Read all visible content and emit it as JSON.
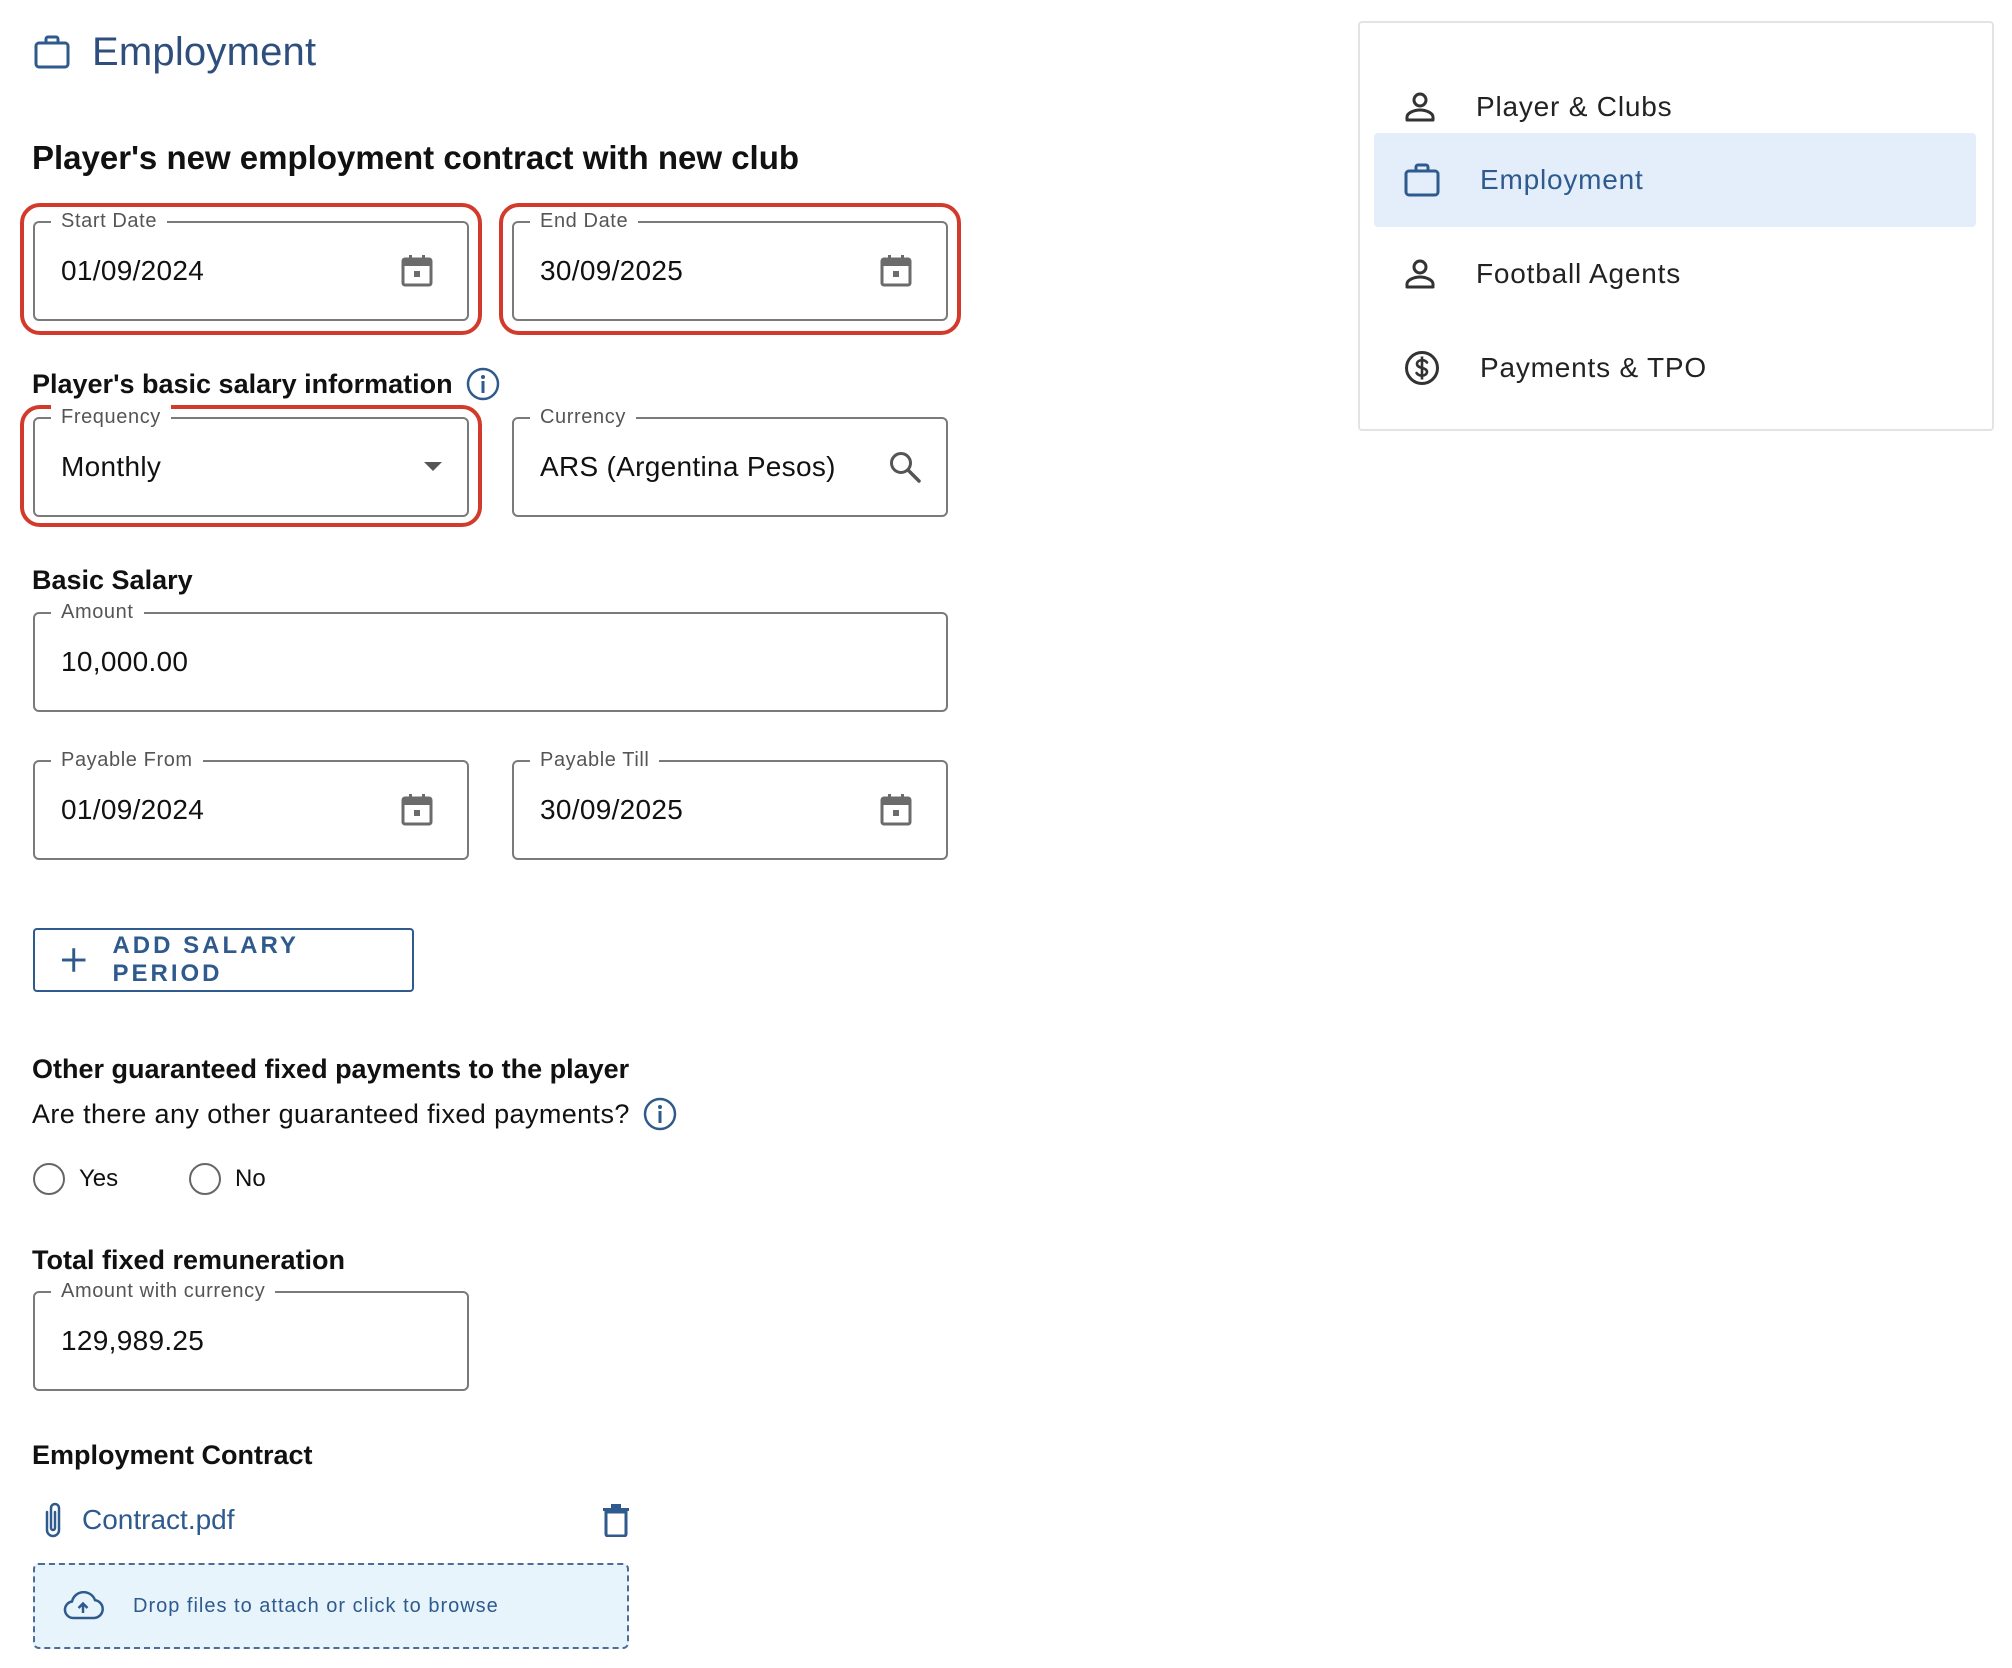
{
  "header": {
    "title": "Employment",
    "icon": "briefcase-icon"
  },
  "section_heading": "Player's new employment contract with new club",
  "contract_dates": {
    "start_date": {
      "label": "Start Date",
      "value": "01/09/2024"
    },
    "end_date": {
      "label": "End Date",
      "value": "30/09/2025"
    }
  },
  "salary_info": {
    "heading": "Player's basic salary information",
    "frequency": {
      "label": "Frequency",
      "value": "Monthly"
    },
    "currency": {
      "label": "Currency",
      "value": "ARS (Argentina Pesos)"
    }
  },
  "basic_salary": {
    "heading": "Basic Salary",
    "amount": {
      "label": "Amount",
      "value": "10,000.00"
    },
    "payable_from": {
      "label": "Payable From",
      "value": "01/09/2024"
    },
    "payable_till": {
      "label": "Payable Till",
      "value": "30/09/2025"
    },
    "add_button": "ADD SALARY PERIOD"
  },
  "other_payments": {
    "heading": "Other guaranteed fixed payments to the player",
    "question": "Are there any other guaranteed fixed payments?",
    "options": [
      "Yes",
      "No"
    ]
  },
  "total": {
    "heading": "Total fixed remuneration",
    "amount": {
      "label": "Amount with currency",
      "value": "129,989.25"
    }
  },
  "contract": {
    "heading": "Employment Contract",
    "file_name": "Contract.pdf",
    "dropzone_text": "Drop files to attach or click to browse"
  },
  "sidebar": {
    "items": [
      {
        "label": "Player & Clubs",
        "icon": "person-icon",
        "active": false
      },
      {
        "label": "Employment",
        "icon": "briefcase-icon",
        "active": true
      },
      {
        "label": "Football Agents",
        "icon": "person-icon",
        "active": false
      },
      {
        "label": "Payments & TPO",
        "icon": "dollar-circle-icon",
        "active": false
      }
    ]
  },
  "colors": {
    "accent": "#2e5a8e",
    "highlight": "#d23a2c",
    "active_bg": "#e3eefa",
    "dropzone_bg": "#e8f4fb"
  }
}
